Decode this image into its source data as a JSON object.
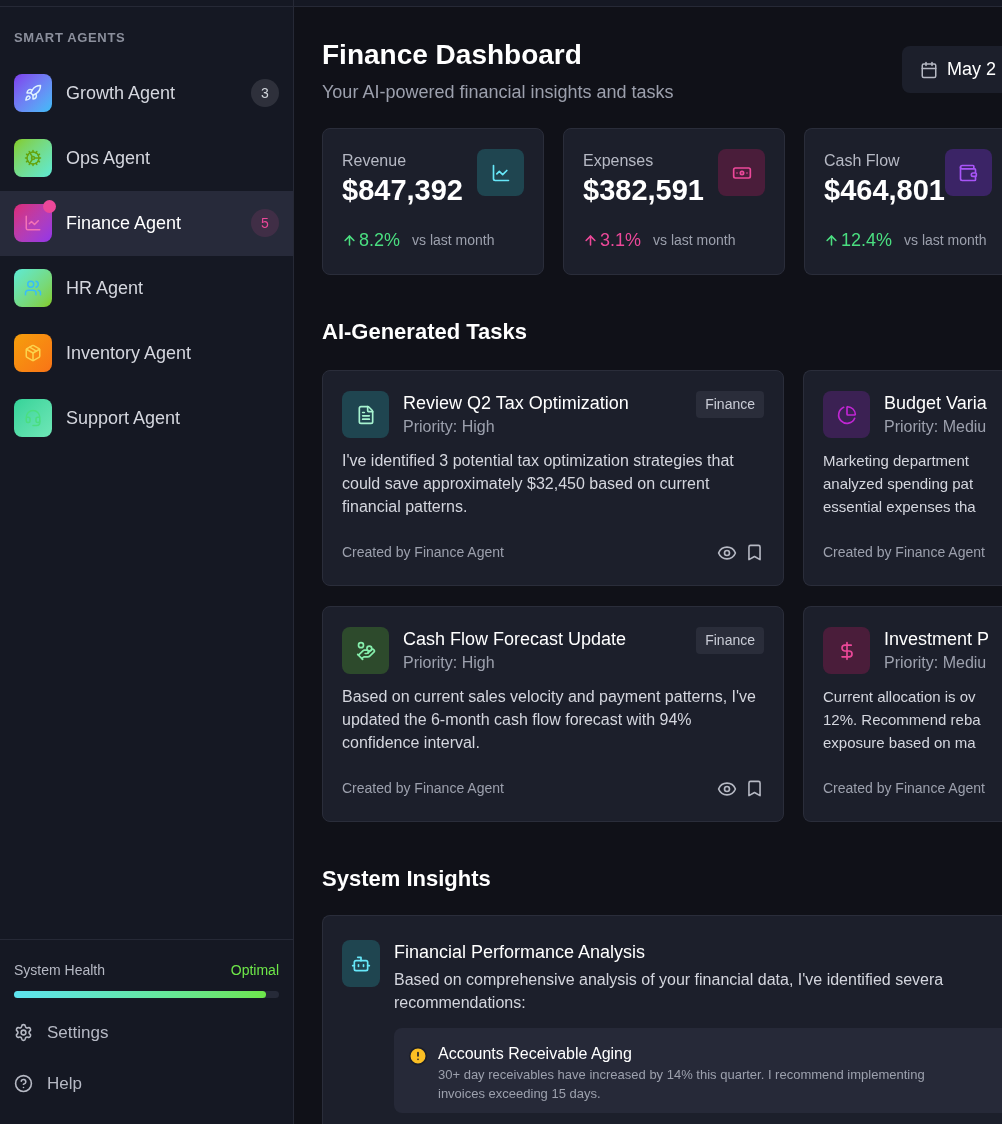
{
  "sidebar": {
    "section_title": "SMART AGENTS",
    "items": [
      {
        "label": "Growth Agent",
        "selected": false,
        "notification": false,
        "badge": {
          "text": "3",
          "color": "#d1d5db"
        }
      },
      {
        "label": "Ops Agent",
        "selected": false,
        "notification": false
      },
      {
        "label": "Finance Agent",
        "selected": true,
        "notification": true,
        "badge": {
          "text": "5",
          "color": "#ec4899"
        }
      },
      {
        "label": "HR Agent",
        "selected": false,
        "notification": false
      },
      {
        "label": "Inventory Agent",
        "selected": false,
        "notification": false
      },
      {
        "label": "Support Agent",
        "selected": false,
        "notification": false
      }
    ],
    "system_health": {
      "label": "System Health",
      "status": "Optimal",
      "level": 0.95
    },
    "footer_links": [
      {
        "label": "Settings"
      },
      {
        "label": "Help"
      }
    ]
  },
  "header": {
    "title": "Finance Dashboard",
    "subtitle": "Your AI-powered financial insights and tasks",
    "date_button": "May 2"
  },
  "stats": [
    {
      "label": "Revenue",
      "value": "$847,392",
      "change": "8.2%",
      "color": "#4ade80",
      "note": "vs last month"
    },
    {
      "label": "Expenses",
      "value": "$382,591",
      "change": "3.1%",
      "color": "#ec4899",
      "note": "vs last month"
    },
    {
      "label": "Cash Flow",
      "value": "$464,801",
      "change": "12.4%",
      "color": "#4ade80",
      "note": "vs last month"
    }
  ],
  "tasks_title": "AI-Generated Tasks",
  "tasks": [
    {
      "title": "Review Q2 Tax Optimization",
      "priority": "Priority: High",
      "tag": "Finance",
      "body": "I've identified 3 potential tax optimization strategies that could save approximately $32,450 based on current financial patterns.",
      "footer": "Created by Finance Agent"
    },
    {
      "title": "Budget Varia",
      "priority": "Priority: Mediu",
      "body_lines": [
        "Marketing department",
        "analyzed spending pat",
        "essential expenses tha"
      ],
      "footer": "Created by Finance Agent"
    },
    {
      "title": "Cash Flow Forecast Update",
      "priority": "Priority: High",
      "tag": "Finance",
      "body": "Based on current sales velocity and payment patterns, I've updated the 6-month cash flow forecast with 94% confidence interval.",
      "footer": "Created by Finance Agent"
    },
    {
      "title": "Investment P",
      "priority": "Priority: Mediu",
      "body_lines": [
        "Current allocation is ov",
        "12%. Recommend reba",
        "exposure based on ma"
      ],
      "footer": "Created by Finance Agent"
    }
  ],
  "insights_title": "System Insights",
  "insight": {
    "title": "Financial Performance Analysis",
    "body_lines": [
      "Based on comprehensive analysis of your financial data, I've identified severa",
      "recommendations:"
    ],
    "alert": {
      "title": "Accounts Receivable Aging",
      "body_lines": [
        "30+ day receivables have increased by 14% this quarter. I recommend implementing",
        "invoices exceeding 15 days."
      ]
    }
  }
}
